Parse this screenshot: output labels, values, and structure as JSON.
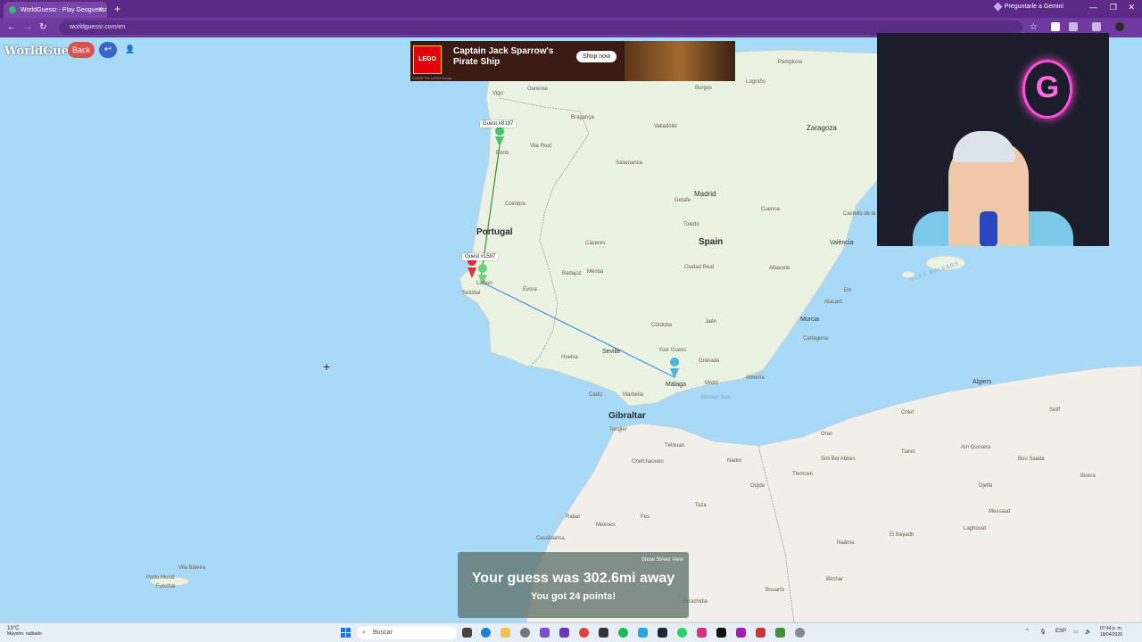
{
  "browser": {
    "tab_title": "WorldGuessr - Play Geoguessr",
    "new_tab_symbol": "+",
    "url": "worldguessr.com/en",
    "gemini_label": "Preguntarle a Gemini"
  },
  "game": {
    "logo": "WorldGuessr",
    "back_label": "Back",
    "guest_pin_1": "Guest #8197",
    "guest_pin_2": "Guest #1597",
    "your_guess_label": "Your Guess"
  },
  "ad": {
    "brand": "LEGO",
    "title": "Captain Jack Sparrow's Pirate Ship",
    "cta": "Shop now",
    "copyright": "©2025 The LEGO Group"
  },
  "result": {
    "show_street_view": "Show Street View",
    "distance_text": "Your guess was 302.6mi away",
    "points_text": "You got 24 points!"
  },
  "map": {
    "countries": [
      "Portugal",
      "Spain",
      "Gibraltar"
    ],
    "cities": {
      "vigo": "Vigo",
      "ourense": "Ourense",
      "braganca": "Bragança",
      "porto": "Porto",
      "vila_real": "Vila Real",
      "coimbra": "Coimbra",
      "lisbon": "Lisbon",
      "setubal": "Setúbal",
      "evora": "Évora",
      "badajoz": "Badajoz",
      "merida": "Mérida",
      "caceres": "Cáceres",
      "salamanca": "Salamanca",
      "valladolid": "Valladolid",
      "burgos": "Burgos",
      "logrono": "Logroño",
      "pamplona": "Pamplona",
      "zaragoza": "Zaragoza",
      "madrid": "Madrid",
      "getafe": "Getafe",
      "toledo": "Toledo",
      "cuenca": "Cuenca",
      "valencia": "València",
      "castellon": "Castelló de la Plana",
      "albacete": "Albacete",
      "alicante": "Alacant",
      "elche": "Elx",
      "murcia": "Murcia",
      "cartagena": "Cartagena",
      "ciudad_real": "Ciudad Real",
      "cordoba": "Córdoba",
      "jaen": "Jaén",
      "sevilla": "Seville",
      "huelva": "Huelva",
      "cadiz": "Cádiz",
      "marbella": "Marbella",
      "malaga": "Málaga",
      "granada": "Granada",
      "almeria": "Almería",
      "motril": "Motril",
      "tangier": "Tangier",
      "tetouan": "Tétouan",
      "chefchaouen": "Chefchaouen",
      "nador": "Nador",
      "oujda": "Oujda",
      "taza": "Taza",
      "fes": "Fes",
      "meknes": "Meknes",
      "rabat": "Rabat",
      "casablanca": "Casablanca",
      "oran": "Oran",
      "algiers": "Algiers",
      "tiaret": "Tiaret",
      "tlemcen": "Tlemcen",
      "sidi_bel_abbes": "Sidi Bel Abbès",
      "chlef": "Chlef",
      "setif": "Sétif",
      "bou_saada": "Bou Saada",
      "djelfa": "Djelfa",
      "biskra": "Biskra",
      "laghouat": "Laghouat",
      "messaad": "Messaad",
      "el_bayadh": "El Bayadh",
      "naama": "Naâma",
      "bechar": "Béchar",
      "bouarfa": "Bouarfa",
      "errachidia": "Errachidia",
      "ain_oussera": "Aïn Oussera",
      "funchal": "Funchal",
      "vila_baleira": "Vila Baleira",
      "porto_moniz": "Porto Moniz",
      "illes_balears": "ILLES BALEARS",
      "alboran_sea": "Alboran Sea"
    }
  },
  "taskbar": {
    "temp": "13°C",
    "weather_desc": "Mayorm. nublado",
    "search_placeholder": "Buscar",
    "language": "ESP",
    "time": "07:44 p. m.",
    "date": "18/04/2026"
  }
}
